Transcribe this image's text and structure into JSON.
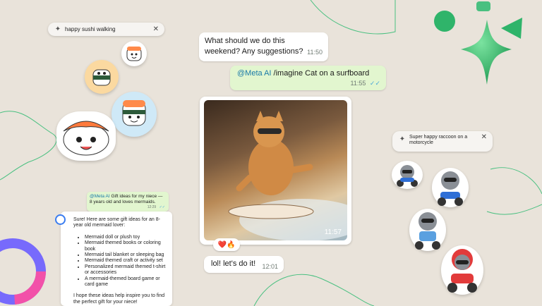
{
  "chips": {
    "left": {
      "text": "happy sushi walking",
      "close": "✕"
    },
    "right": {
      "text": "Super happy raccoon on a motorcycle",
      "close": "✕"
    }
  },
  "chat": {
    "msg1": {
      "text": "What should we do this weekend? Any suggestions?",
      "time": "11:50"
    },
    "msg2": {
      "mention": "@Meta AI",
      "text": "/imagine Cat on a surfboard",
      "time": "11:55",
      "ticks": "✓✓"
    },
    "photo": {
      "alt": "Cat with sunglasses surfing a wave",
      "time": "11:57",
      "reactions": "❤️🔥"
    },
    "msg3": {
      "text": "lol! let's do it!",
      "time": "12:01"
    }
  },
  "mini": {
    "request": {
      "mention": "@Meta AI",
      "text": "Gift ideas for my niece —8 years old and loves mermaids.",
      "time": "12:29",
      "ticks": "✓✓"
    },
    "answer": {
      "intro": "Sure! Here are some gift ideas for an 8-year old mermaid lover:",
      "items": [
        "Mermaid doll or plush toy",
        "Mermaid themed books or coloring book",
        "Mermaid tail blanket or sleeping bag",
        "Mermaid themed craft or activity set",
        "Personalized mermaid themed t-shirt or accessories",
        "A mermaid-themed board game or card game"
      ],
      "outro": "I hope these ideas help inspire you to find the perfect gift for your niece!"
    }
  },
  "icons": {
    "sparkle": "sparkle-icon",
    "close": "close-icon",
    "sushi": "sushi-sticker",
    "raccoon": "raccoon-sticker",
    "star": "green-star-icon"
  },
  "colors": {
    "background": "#e9e3da",
    "incoming": "#ffffff",
    "outgoing": "#e2f6cf",
    "mention": "#1a7aa8",
    "accent_green": "#2fb46a"
  }
}
